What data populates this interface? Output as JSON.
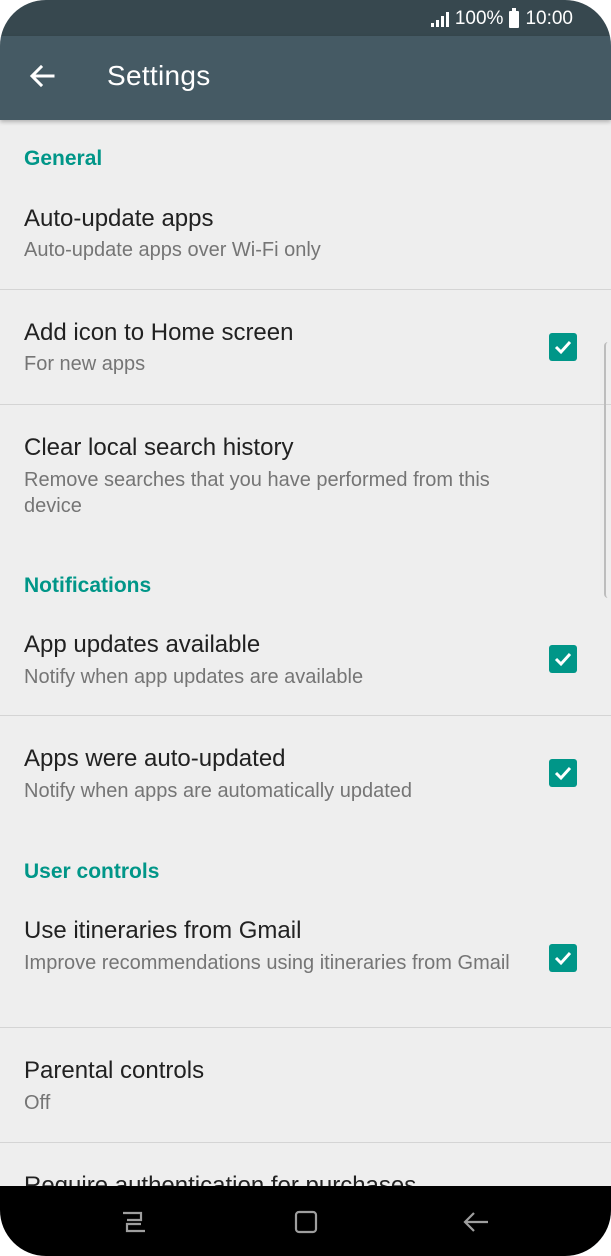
{
  "status_bar": {
    "battery": "100%",
    "time": "10:00",
    "icons": [
      "signal-icon",
      "battery-icon"
    ]
  },
  "app_bar": {
    "title": "Settings",
    "back_icon": "arrow-left-icon"
  },
  "sections": [
    {
      "header": "General",
      "items": [
        {
          "title": "Auto-update apps",
          "summary": "Auto-update apps over Wi-Fi only",
          "checkbox": null
        },
        {
          "title": "Add icon to Home screen",
          "summary": "For new apps",
          "checkbox": true
        },
        {
          "title": "Clear local search history",
          "summary": "Remove searches that you have performed from this device",
          "checkbox": null
        }
      ]
    },
    {
      "header": "Notifications",
      "items": [
        {
          "title": "App updates available",
          "summary": "Notify when app updates are available",
          "checkbox": true
        },
        {
          "title": "Apps were auto-updated",
          "summary": "Notify when apps are automatically updated",
          "checkbox": true
        }
      ]
    },
    {
      "header": "User controls",
      "items": [
        {
          "title": "Use itineraries from Gmail",
          "summary": "Improve recommendations using itineraries from Gmail",
          "checkbox": true
        },
        {
          "title": "Parental controls",
          "summary": "Off",
          "checkbox": null
        },
        {
          "title": "Require authentication for purchases",
          "summary": "",
          "checkbox": null
        }
      ]
    }
  ],
  "nav_bar": {
    "icons": [
      "recents-icon",
      "home-icon",
      "back-icon"
    ]
  },
  "colors": {
    "accent": "#009688",
    "app_bar": "#455a64",
    "status_bar": "#37484f",
    "background": "#eeeeee"
  }
}
